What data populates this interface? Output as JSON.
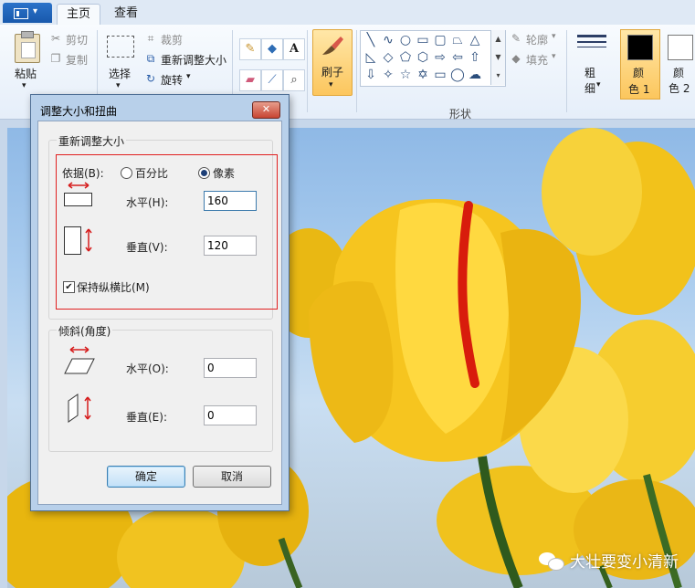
{
  "ribbon": {
    "tabs": [
      "主页",
      "查看"
    ],
    "clipboard": {
      "paste": "粘贴",
      "cut": "剪切",
      "copy": "复制"
    },
    "image": {
      "select": "选择",
      "crop": "裁剪",
      "resize": "重新调整大小",
      "rotate": "旋转"
    },
    "brush": "刷子",
    "shapes": {
      "outline": "轮廓",
      "fill": "填充",
      "group_label": "形状"
    },
    "thickness": [
      "粗",
      "细"
    ],
    "colors": [
      {
        "label": [
          "颜",
          "色 1"
        ],
        "value": "#000000"
      },
      {
        "label": [
          "颜",
          "色 2"
        ],
        "value": "#ffffff"
      }
    ]
  },
  "dialog": {
    "title": "调整大小和扭曲",
    "resize": {
      "group_title": "重新调整大小",
      "by_label": "依据(B):",
      "percent_label": "百分比",
      "pixel_label": "像素",
      "selected_unit": "像素",
      "horizontal_label": "水平(H):",
      "horizontal_value": "160",
      "vertical_label": "垂直(V):",
      "vertical_value": "120",
      "keep_ratio_label": "保持纵横比(M)",
      "keep_ratio_checked": true
    },
    "skew": {
      "group_title": "倾斜(角度)",
      "horizontal_label": "水平(O):",
      "horizontal_value": "0",
      "vertical_label": "垂直(E):",
      "vertical_value": "0"
    },
    "ok_label": "确定",
    "cancel_label": "取消"
  },
  "watermark": "大壮要变小清新",
  "colors": {
    "accent": "#fcc65d",
    "highlight_border": "#e02020",
    "title_bar": "#b8d0ea"
  }
}
